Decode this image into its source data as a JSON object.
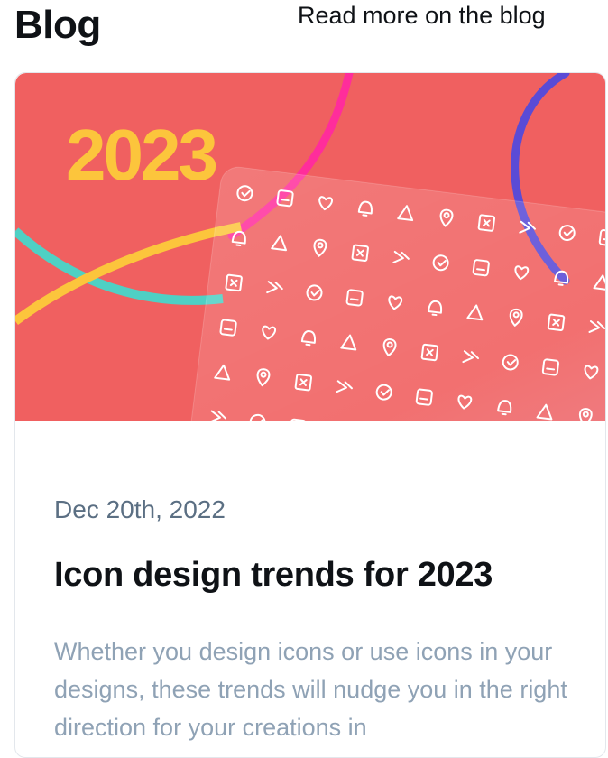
{
  "header": {
    "title": "Blog",
    "more_link": "Read more on the blog"
  },
  "post": {
    "hero_year": "2023",
    "date": "Dec 20th, 2022",
    "title": "Icon design trends for 2023",
    "excerpt": "Whether you design icons or use icons in your designs, these trends will nudge you in the right direction for your creations in"
  },
  "colors": {
    "hero_bg": "#f06060",
    "year_text": "#fcc53c",
    "panel_tint": "#ffffff",
    "ribbon_pink": "#ff2d9b",
    "ribbon_purple": "#5a4bd6",
    "ribbon_teal": "#4fd0c4",
    "ribbon_yellow": "#fcc53c"
  }
}
